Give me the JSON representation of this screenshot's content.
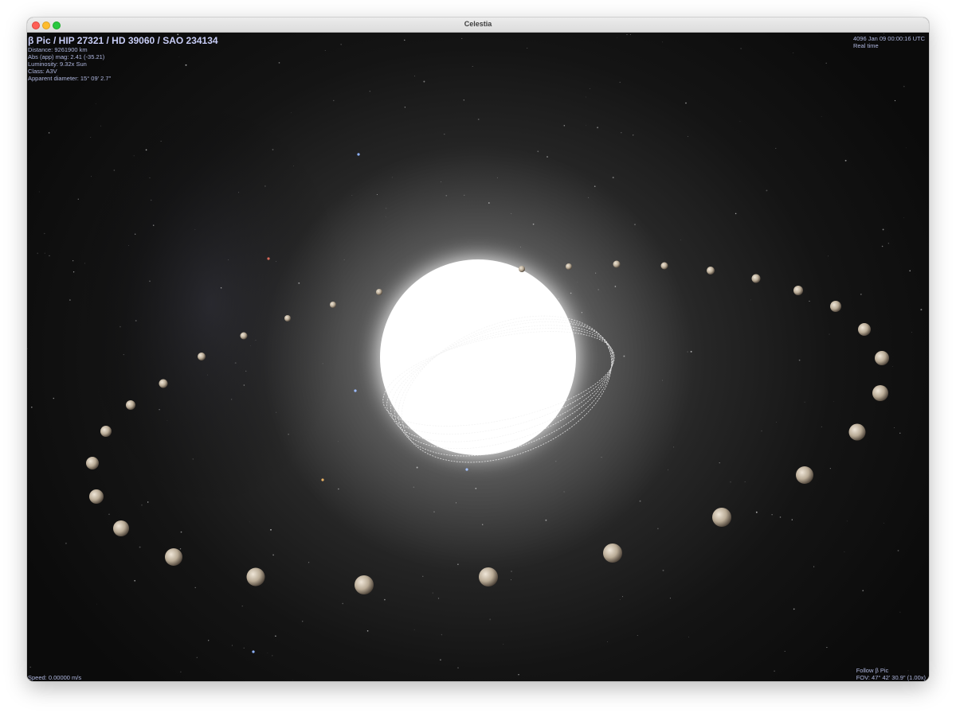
{
  "window": {
    "title": "Celestia"
  },
  "object_info": {
    "title": "β Pic / HIP 27321 / HD 39060 / SAO 234134",
    "distance": "Distance: 9261900 km",
    "abs_mag": "Abs (app) mag: 2.41 (-35.21)",
    "luminosity": "Luminosity: 9.32x Sun",
    "class": "Class: A3V",
    "apparent_diameter": "Apparent diameter: 15° 09' 2.7\""
  },
  "time_info": {
    "datetime": "4096 Jan 09 00:00:16 UTC",
    "rate": "Real time"
  },
  "speed": {
    "text": "Speed: 0.00000 m/s"
  },
  "view_info": {
    "follow": "Follow β Pic",
    "fov": "FOV: 47° 42' 30.9\" (1.00x)"
  },
  "colors": {
    "hud_text": "#b0b8e0",
    "star": "#ffffff",
    "planet": "#cbbfad"
  }
}
